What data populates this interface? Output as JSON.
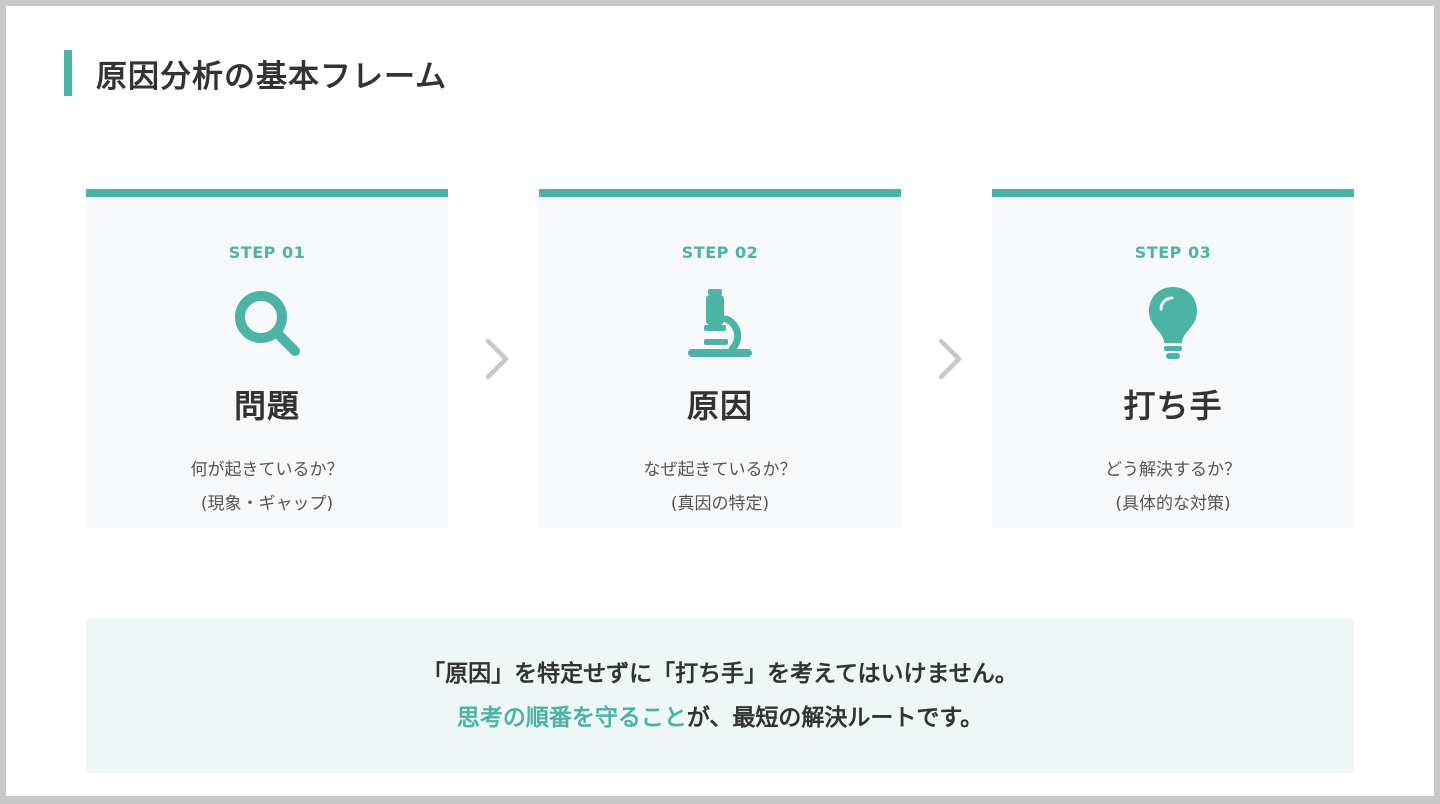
{
  "title": "原因分析の基本フレーム",
  "colors": {
    "accent": "#4db3a4",
    "card_bg": "#f7f8f9",
    "note_bg": "#eef7f6",
    "text": "#333333"
  },
  "steps": [
    {
      "step": "STEP 01",
      "icon": "magnifier-icon",
      "title": "問題",
      "desc1": "何が起きているか？",
      "desc2": "(現象・ギャップ)"
    },
    {
      "step": "STEP 02",
      "icon": "microscope-icon",
      "title": "原因",
      "desc1": "なぜ起きているか？",
      "desc2": "(真因の特定)"
    },
    {
      "step": "STEP 03",
      "icon": "lightbulb-icon",
      "title": "打ち手",
      "desc1": "どう解決するか？",
      "desc2": "(具体的な対策)"
    }
  ],
  "note": {
    "line1": "「原因」を特定せずに「打ち手」を考えてはいけません。",
    "line2_accent": "思考の順番を守ること",
    "line2_rest": "が、最短の解決ルートです。"
  }
}
